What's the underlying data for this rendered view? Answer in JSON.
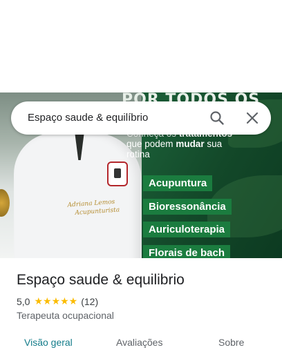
{
  "search": {
    "query": "Espaço saude & equilíbrio"
  },
  "hero": {
    "headline": "POR TODOS OS",
    "sub_line1_pre": "Conheça os ",
    "sub_line1_bold": "tratamentos",
    "sub_line2_pre": "que podem ",
    "sub_line2_bold": "mudar",
    "sub_line2_post": " sua",
    "sub_line3": "rotina",
    "treatments": [
      "Acupuntura",
      "Bioressonância",
      "Auriculoterapia",
      "Florais de bach"
    ],
    "embroidery_line1": "Adriana Lemos",
    "embroidery_line2": "Acupunturista",
    "colors": {
      "background": "#0f4a2c",
      "pill": "#1b7c3f"
    }
  },
  "place": {
    "title": "Espaço saude & equilibrio",
    "rating_value": "5,0",
    "stars": "★★★★★",
    "review_count": "(12)",
    "category": "Terapeuta ocupacional"
  },
  "tabs": [
    {
      "label": "Visão geral",
      "active": true
    },
    {
      "label": "Avaliações",
      "active": false
    },
    {
      "label": "Sobre",
      "active": false
    }
  ],
  "colors": {
    "accent": "#137c8a",
    "star": "#fbbc04"
  }
}
